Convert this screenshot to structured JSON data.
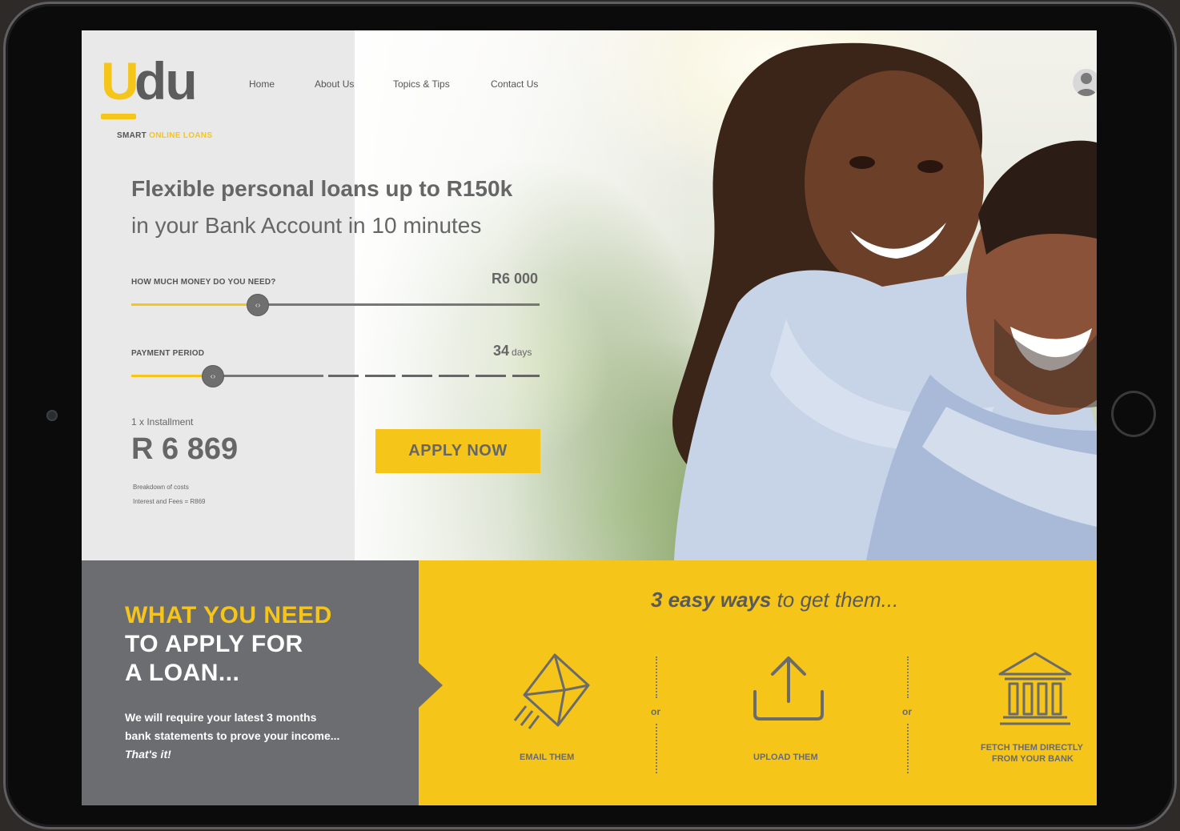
{
  "brand": {
    "logo_u": "U",
    "logo_du": "du",
    "tagline_smart": "SMART ",
    "tagline_rest": "ONLINE LOANS"
  },
  "nav": {
    "home": "Home",
    "about": "About Us",
    "topics": "Topics & Tips",
    "contact": "Contact Us"
  },
  "hero": {
    "headline": "Flexible personal loans up to R150k",
    "subline": "in your Bank Account in 10 minutes"
  },
  "calculator": {
    "amount_label": "HOW MUCH MONEY DO YOU NEED?",
    "amount_value": "R6 000",
    "amount_slider_position": 0.31,
    "period_label": "PAYMENT PERIOD",
    "period_value": "34",
    "period_unit": "days",
    "period_slider_position": 0.2,
    "installment_label": "1 x Installment",
    "installment_value": "R 6 869",
    "fine_print_1": "Breakdown of costs",
    "fine_print_2": "Interest and Fees = R869",
    "apply_label": "APPLY NOW"
  },
  "requirements": {
    "title_line1": "WHAT YOU NEED",
    "title_line2": "TO APPLY FOR",
    "title_line3": "A LOAN...",
    "body_line1": "We will require your latest 3 months",
    "body_line2": "bank statements to prove your income...",
    "body_line3": "That's it!"
  },
  "ways": {
    "title_em": "3 easy ways",
    "title_rest": " to get them...",
    "or_label": "or",
    "email_label": "EMAIL THEM",
    "upload_label": "UPLOAD THEM",
    "bank_label_1": "FETCH THEM DIRECTLY",
    "bank_label_2": "FROM YOUR BANK"
  },
  "icons": {
    "user": "user-icon",
    "email": "envelope-icon",
    "upload": "upload-icon",
    "bank": "bank-icon"
  },
  "colors": {
    "brand_yellow": "#f5c51a",
    "dark_grey": "#6c6d70",
    "text_grey": "#666666"
  }
}
